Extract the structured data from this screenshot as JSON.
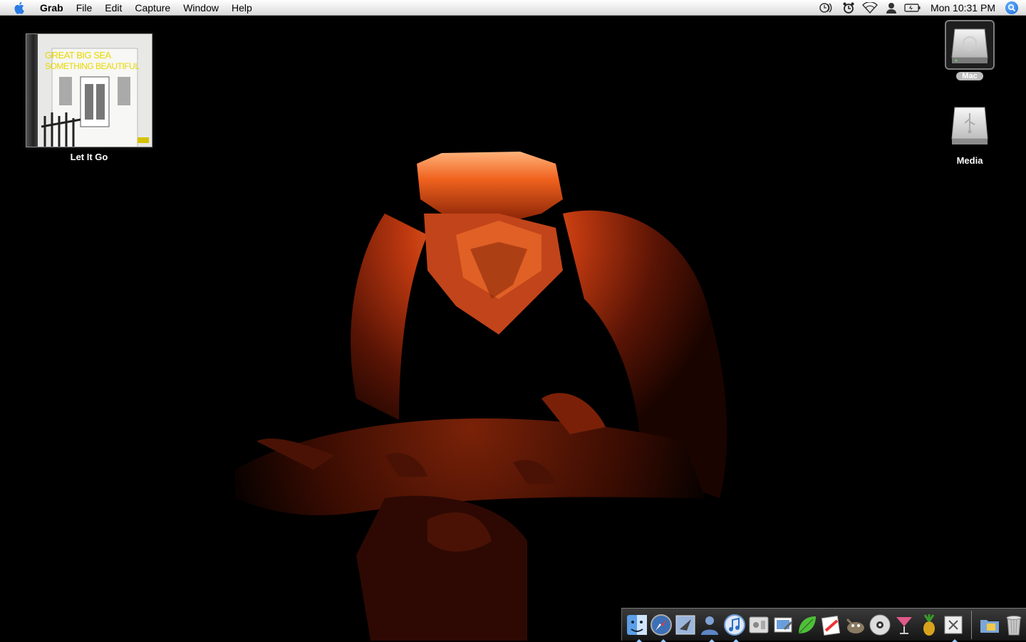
{
  "menubar": {
    "apple_icon": "apple-logo-icon",
    "app_name": "Grab",
    "menus": [
      "File",
      "Edit",
      "Capture",
      "Window",
      "Help"
    ],
    "status_icons": [
      "time-machine-icon",
      "alarm-clock-icon",
      "wifi-icon",
      "user-icon",
      "battery-icon"
    ],
    "clock": "Mon 10:31 PM",
    "spotlight_icon": "spotlight-search-icon"
  },
  "desktop": {
    "album": {
      "label": "Let It Go",
      "cover_line1": "GREAT BIG SEA",
      "cover_line2": "SOMETHING BEAUTIFUL"
    },
    "drives": [
      {
        "label": "Mac",
        "icon": "hard-drive-icon",
        "selected": true
      },
      {
        "label": "Media",
        "icon": "usb-drive-icon",
        "selected": false
      }
    ]
  },
  "dock": {
    "apps": [
      {
        "name": "Finder",
        "icon": "finder-icon",
        "running": true
      },
      {
        "name": "Safari",
        "icon": "safari-icon",
        "running": true
      },
      {
        "name": "Mail",
        "icon": "mail-icon",
        "running": false
      },
      {
        "name": "iChat",
        "icon": "ichat-icon",
        "running": true
      },
      {
        "name": "iTunes",
        "icon": "itunes-icon",
        "running": true
      },
      {
        "name": "System Preferences",
        "icon": "system-preferences-icon",
        "running": false
      },
      {
        "name": "Preview",
        "icon": "preview-icon",
        "running": false
      },
      {
        "name": "Coda",
        "icon": "leaf-icon",
        "running": false
      },
      {
        "name": "CSSEdit",
        "icon": "cssedit-icon",
        "running": false
      },
      {
        "name": "GIMP",
        "icon": "gimp-icon",
        "running": false
      },
      {
        "name": "DVD Player",
        "icon": "dvd-icon",
        "running": false
      },
      {
        "name": "Cocktail",
        "icon": "cocktail-icon",
        "running": false
      },
      {
        "name": "Pineapple",
        "icon": "pineapple-icon",
        "running": false
      },
      {
        "name": "Grab",
        "icon": "grab-icon",
        "running": true
      }
    ],
    "stacks": [
      {
        "name": "Documents",
        "icon": "folder-icon"
      },
      {
        "name": "Trash",
        "icon": "trash-icon"
      }
    ]
  },
  "colors": {
    "desktop_bg": "#000000",
    "carving_glow": "#e5541c",
    "label_selected_bg": "#bdbdbd",
    "album_text": "#e8d800"
  }
}
